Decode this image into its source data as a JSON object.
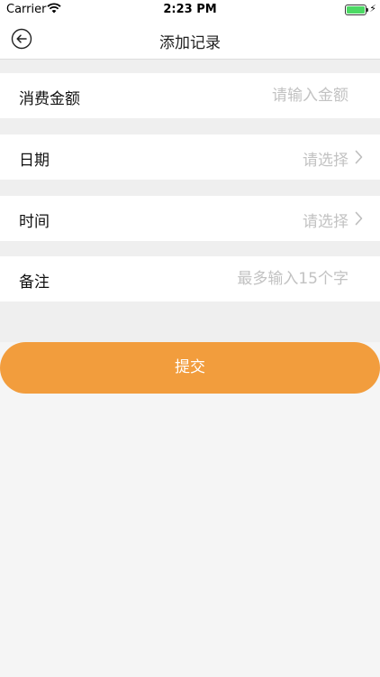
{
  "status_bar": {
    "carrier": "Carrier",
    "time": "2:23 PM",
    "wifi_icon": "wifi-icon",
    "battery_icon": "battery-icon",
    "battery_level": 1.0
  },
  "nav": {
    "title": "添加记录",
    "back_icon": "circle-back-arrow-icon"
  },
  "form": {
    "amount": {
      "label": "消费金额",
      "placeholder": "请输入金额"
    },
    "date": {
      "label": "日期",
      "value": "请选择"
    },
    "time": {
      "label": "时间",
      "value": "请选择"
    },
    "note": {
      "label": "备注",
      "placeholder": "最多输入15个字"
    }
  },
  "submit": {
    "label": "提交"
  },
  "colors": {
    "accent": "#f29d3d",
    "background": "#f5f5f5",
    "form_background": "#efefef",
    "placeholder": "#c2c2c2",
    "battery": "#4cd964"
  }
}
